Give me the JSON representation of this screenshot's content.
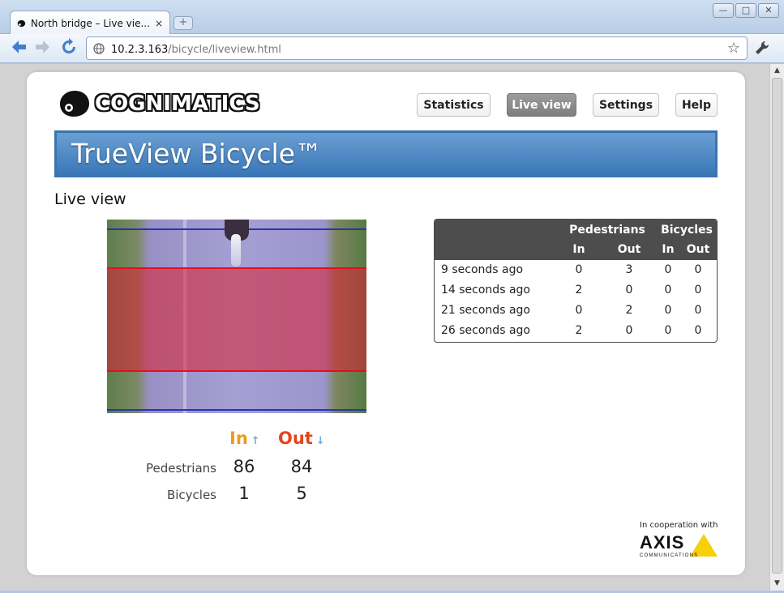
{
  "browser": {
    "tab_title": "North bridge – Live vie...",
    "tab_close": "×",
    "new_tab": "+",
    "window_minimize": "—",
    "window_maximize": "□",
    "window_close": "✕",
    "url_host": "10.2.3.163",
    "url_path": "/bicycle/liveview.html"
  },
  "header": {
    "logo_text": "COGNIMATICS",
    "nav": [
      {
        "label": "Statistics",
        "active": false
      },
      {
        "label": "Live view",
        "active": true
      },
      {
        "label": "Settings",
        "active": false
      },
      {
        "label": "Help",
        "active": false
      }
    ]
  },
  "banner": {
    "title": "TrueView Bicycle™"
  },
  "main": {
    "section_title": "Live view",
    "counts": {
      "in_label": "In",
      "out_label": "Out",
      "rows": [
        {
          "label": "Pedestrians",
          "in": "86",
          "out": "84"
        },
        {
          "label": "Bicycles",
          "in": "1",
          "out": "5"
        }
      ]
    },
    "recent_table": {
      "group_headers": [
        "Pedestrians",
        "Bicycles"
      ],
      "sub_headers": [
        "In",
        "Out",
        "In",
        "Out"
      ],
      "rows": [
        {
          "time": "9 seconds ago",
          "ped_in": "0",
          "ped_out": "3",
          "bic_in": "0",
          "bic_out": "0"
        },
        {
          "time": "14 seconds ago",
          "ped_in": "2",
          "ped_out": "0",
          "bic_in": "0",
          "bic_out": "0"
        },
        {
          "time": "21 seconds ago",
          "ped_in": "0",
          "ped_out": "2",
          "bic_in": "0",
          "bic_out": "0"
        },
        {
          "time": "26 seconds ago",
          "ped_in": "2",
          "ped_out": "0",
          "bic_in": "0",
          "bic_out": "0"
        }
      ]
    }
  },
  "footer": {
    "cooperation": "In cooperation with",
    "partner_logo": "AXIS",
    "partner_sub": "COMMUNICATIONS"
  },
  "colors": {
    "in_accent": "#ee9a1c",
    "out_accent": "#e2461c",
    "banner_blue": "#3977b8",
    "table_header": "#4d4d4d"
  },
  "icons": [
    "back-icon",
    "forward-icon",
    "reload-icon",
    "globe-icon",
    "bookmark-star-icon",
    "wrench-icon",
    "arrow-up-icon",
    "arrow-down-icon"
  ]
}
